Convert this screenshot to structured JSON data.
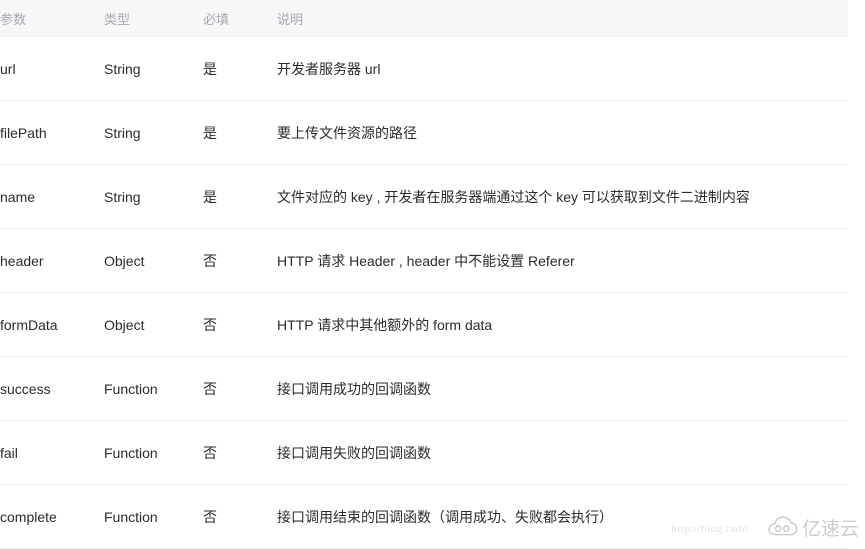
{
  "table": {
    "columns": [
      {
        "key": "param",
        "label": "参数"
      },
      {
        "key": "type",
        "label": "类型"
      },
      {
        "key": "required",
        "label": "必填"
      },
      {
        "key": "desc",
        "label": "说明"
      }
    ],
    "rows": [
      {
        "param": "url",
        "type": "String",
        "required": "是",
        "desc": "开发者服务器 url"
      },
      {
        "param": "filePath",
        "type": "String",
        "required": "是",
        "desc": "要上传文件资源的路径"
      },
      {
        "param": "name",
        "type": "String",
        "required": "是",
        "desc": "文件对应的 key , 开发者在服务器端通过这个 key 可以获取到文件二进制内容"
      },
      {
        "param": "header",
        "type": "Object",
        "required": "否",
        "desc": "HTTP 请求 Header , header 中不能设置 Referer"
      },
      {
        "param": "formData",
        "type": "Object",
        "required": "否",
        "desc": "HTTP 请求中其他额外的 form data"
      },
      {
        "param": "success",
        "type": "Function",
        "required": "否",
        "desc": "接口调用成功的回调函数"
      },
      {
        "param": "fail",
        "type": "Function",
        "required": "否",
        "desc": "接口调用失败的回调函数"
      },
      {
        "param": "complete",
        "type": "Function",
        "required": "否",
        "desc": "接口调用结束的回调函数（调用成功、失败都会执行）"
      }
    ]
  },
  "watermark": {
    "url": "http://blog.csdn",
    "brand": "亿速云",
    "logo_icon": "cloud-swirl-icon"
  },
  "colors": {
    "header_background": "#f6f7f8",
    "header_text": "#a6a9ad",
    "body_text": "#2b2b2b",
    "row_divider": "#ededf0",
    "watermark_text": "#c9ccd1",
    "watermark_url": "#e2e3e5"
  }
}
